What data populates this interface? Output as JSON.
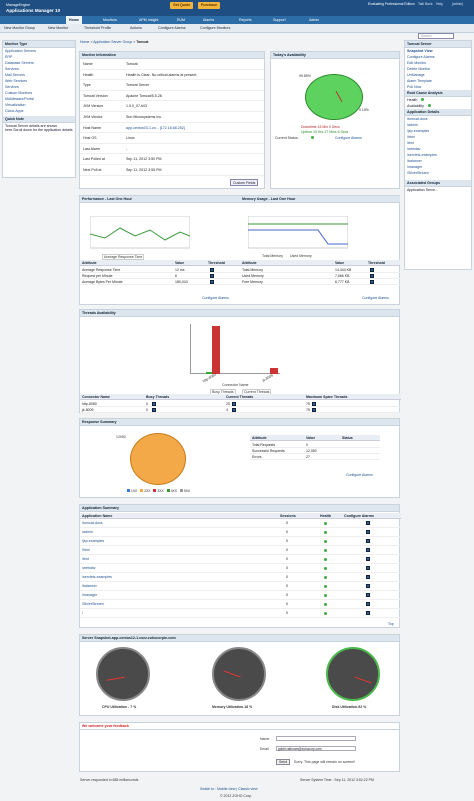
{
  "header": {
    "logo_top": "ManageEngine",
    "logo_main": "Applications Manager 10",
    "get_quote": "Get Quote",
    "purchase": "Purchase",
    "eval": "Evaluating Professional Edition",
    "talk": "Talk Back",
    "help": "Help",
    "user": "[admin]"
  },
  "nav": [
    "Home",
    "Monitors",
    "APM Insight",
    "EUM",
    "Alarms",
    "Reports",
    "Support",
    "Admin"
  ],
  "search_placeholder": "Search",
  "subnav": {
    "new_monitor_group": "New Monitor Group",
    "new_monitor": "New Monitor",
    "threshold_profile": "Threshold Profile",
    "actions": "Actions",
    "configure_alarms": "Configure Alarms",
    "configure_monitors": "Configure Monitors"
  },
  "breadcrumb": [
    "Home",
    "Application Server Group",
    "Tomcat"
  ],
  "left": {
    "title": "Monitor Type",
    "items": [
      "Application Servers",
      "ERP",
      "Database Servers",
      "Services",
      "Mail Servers",
      "Web Services",
      "Services",
      "Custom Monitors",
      "Middleware/Portal",
      "Virtualization",
      "Cloud Apps"
    ],
    "quicknote_title": "Quick Note",
    "quicknote": "Tomcat Server details are shown here.Scroll down for the application details"
  },
  "monitor_info": {
    "title": "Monitor Information",
    "rows": [
      [
        "Name",
        "Tomcat"
      ],
      [
        "Health",
        "Health is Clear- No critical alarms at present."
      ],
      [
        "Type",
        "Tomcat Server"
      ],
      [
        "Tomcat Version",
        "Apache Tomcat/5.5.28"
      ],
      [
        "JVM Version",
        "1.5.0_07-b03"
      ],
      [
        "JVM Vendor",
        "Sun Microsystems Inc."
      ],
      [
        "Host Name",
        "app-centos03-1.zo... [172.18.68.252]"
      ],
      [
        "Host OS",
        "Linux"
      ],
      [
        "Last Alarm",
        "-"
      ],
      [
        "Last Polled at",
        "Sep 11, 2012 3:50 PM"
      ],
      [
        "Next Poll at",
        "Sep 11, 2012 3:55 PM"
      ]
    ],
    "custom_fields": "Custom Fields"
  },
  "availability": {
    "title": "Today's Availability",
    "pct_up": "99.85%",
    "pct_down": "0.15%",
    "legend_down": "Downtime 15 Min 0 Secs",
    "legend_up": "Uptime 15 Hrs 27 Mins 6 Secs",
    "current_status": "Current Status :",
    "configure": "Configure Alarms"
  },
  "right": {
    "title": "Tomcat Server",
    "snapshot": "Snapshot View",
    "items": [
      "Configure Alarms",
      "Edit Monitor",
      "Delete Monitor",
      "UnManage",
      "Alarm Template",
      "Poll Now"
    ],
    "rca_title": "Root Cause Analysis",
    "rca": [
      "Health",
      "Availability"
    ],
    "app_details_title": "Application Details",
    "apps": [
      "/tomcat-docs",
      "/admin",
      "/jsp-examples",
      "/html",
      "/test",
      "/webdav",
      "/servlets-examples",
      "/balancer",
      "/manager",
      "/SilverStream"
    ],
    "assoc_title": "Associated Groups",
    "assoc": [
      "Application Serve..."
    ]
  },
  "performance": {
    "title": "Performance - Last One Hour",
    "ylabel": "Value in ms",
    "xlabel": "Time",
    "legend": "Average Response Time",
    "xticks": [
      "14:00",
      "14:40",
      "15:00",
      "15:20"
    ],
    "table_head": [
      "Attribute",
      "Value",
      "Threshold"
    ],
    "rows": [
      [
        "Average Response Time",
        "12 ms"
      ],
      [
        "Request per Minute",
        "6"
      ],
      [
        "Average Bytes Per Minute",
        "180,043"
      ]
    ],
    "configure": "Configure Alarms"
  },
  "memory": {
    "title": "Memory Usage - Last One Hour",
    "ylabel": "Value in KB",
    "xlabel": "Time",
    "legend": [
      "Total Memory",
      "Used Memory"
    ],
    "xticks": [
      "14:40",
      "15:00",
      "15:20",
      "15:40"
    ],
    "table_head": [
      "Attribute",
      "Value",
      "Threshold"
    ],
    "rows": [
      [
        "Total Memory",
        "14,444 KB"
      ],
      [
        "Used Memory",
        "7,666 KB"
      ],
      [
        "Free Memory",
        "6,777 KB"
      ]
    ],
    "configure": "Configure Alarms"
  },
  "threads": {
    "title": "Threads Availability",
    "ylabel": "Number of Threads",
    "xlabel": "Connector Name",
    "legend": [
      "Busy Threads",
      "Current Threads"
    ],
    "categories": [
      "http-8080",
      "jk-8009"
    ],
    "head": [
      "Connector Name",
      "Busy Threads",
      "Current Threads",
      "Maximum Spare Threads"
    ],
    "rows": [
      [
        "http-8080",
        "0",
        "25",
        "75"
      ],
      [
        "jk-8009",
        "0",
        "4",
        "75"
      ]
    ]
  },
  "response": {
    "title": "Response Summary",
    "total_label": "12050",
    "legend": [
      "1XX",
      "2XX",
      "3XX",
      "4XX",
      "5XX"
    ],
    "head": [
      "Attribute",
      "Value",
      "Status"
    ],
    "rows": [
      [
        "Total Requests",
        "0"
      ],
      [
        "Successful Requests",
        "12,050"
      ],
      [
        "Errors",
        "27"
      ]
    ],
    "configure": "Configure Alarms"
  },
  "apps": {
    "title": "Application Summary",
    "head": [
      "Application Name",
      "Sessions",
      "Health",
      "Configure Alarms"
    ],
    "rows": [
      [
        "/tomcat-docs",
        "0"
      ],
      [
        "/admin",
        "0"
      ],
      [
        "/jsp-examples",
        "0"
      ],
      [
        "/html",
        "0"
      ],
      [
        "/test",
        "0"
      ],
      [
        "/webdav",
        "0"
      ],
      [
        "/servlets-examples",
        "0"
      ],
      [
        "/balancer",
        "0"
      ],
      [
        "/manager",
        "0"
      ],
      [
        "/SilverStream",
        "0"
      ],
      [
        "/",
        "0"
      ]
    ],
    "top": "Top"
  },
  "snapshot": {
    "title": "Server Snapshot-app-centos12-1.csez.zohocorpin.com",
    "gauges": [
      "CPU Utilization - 7 %",
      "Memory Utilization-18 %",
      "Disk Utilization-92 %"
    ]
  },
  "feedback": {
    "title": "We welcome your feedback",
    "name_label": "Name",
    "email_label": "Email",
    "email_value": "gobbi.rathnam@zohocorp.com",
    "send": "Send",
    "note": "Sorry. This page will remain on screen!!"
  },
  "footer": {
    "response": "Server responded in 685 milliseconds",
    "time": "Server System Time : Sep 11, 2012 3:52:22 PM",
    "switch": "Switch to : Mobile view | Classic view",
    "copy": "© 2012 ZOHO Corp."
  },
  "colors": {
    "header": "#1f4f82",
    "nav": "#2c6ca7",
    "green": "#3cb043"
  }
}
